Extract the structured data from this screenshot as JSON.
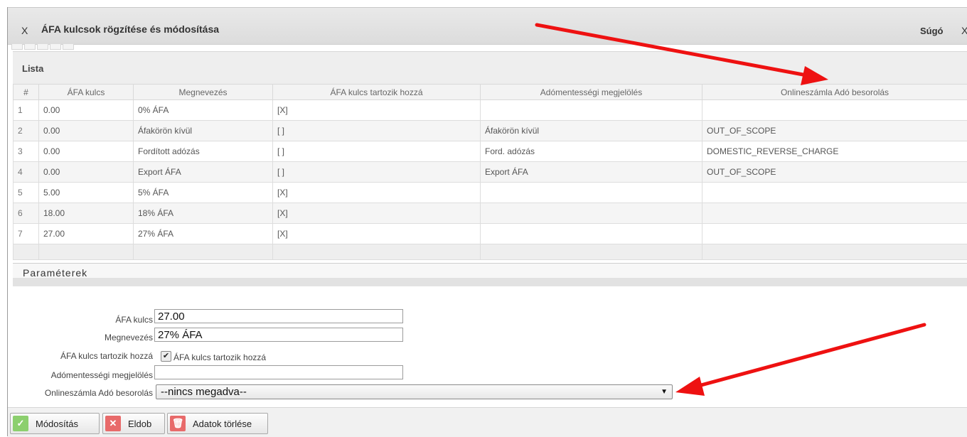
{
  "window": {
    "close_label": "X",
    "title": "ÁFA kulcsok rögzítése és módosítása",
    "help_label": "Súgó",
    "close_right_label": "X"
  },
  "list": {
    "title": "Lista",
    "columns": [
      "#",
      "ÁFA kulcs",
      "Megnevezés",
      "ÁFA kulcs tartozik hozzá",
      "Adómentességi megjelölés",
      "Onlineszámla Adó besorolás"
    ],
    "rows": [
      [
        "1",
        "0.00",
        "0% ÁFA",
        "[X]",
        "",
        ""
      ],
      [
        "2",
        "0.00",
        "Áfakörön kívül",
        "[ ]",
        "Áfakörön kívül",
        "OUT_OF_SCOPE"
      ],
      [
        "3",
        "0.00",
        "Fordított adózás",
        "[ ]",
        "Ford. adózás",
        "DOMESTIC_REVERSE_CHARGE"
      ],
      [
        "4",
        "0.00",
        "Export ÁFA",
        "[ ]",
        "Export ÁFA",
        "OUT_OF_SCOPE"
      ],
      [
        "5",
        "5.00",
        "5% ÁFA",
        "[X]",
        "",
        ""
      ],
      [
        "6",
        "18.00",
        "18% ÁFA",
        "[X]",
        "",
        ""
      ],
      [
        "7",
        "27.00",
        "27% ÁFA",
        "[X]",
        "",
        ""
      ]
    ]
  },
  "params": {
    "title": "Paraméterek",
    "afa_kulcs": {
      "label": "ÁFA kulcs",
      "value": "27.00"
    },
    "megnevezes": {
      "label": "Megnevezés",
      "value": "27% ÁFA"
    },
    "tartozik": {
      "label": "ÁFA kulcs tartozik hozzá",
      "checkbox_label": "ÁFA kulcs tartozik hozzá",
      "checked": true
    },
    "adomentes": {
      "label": "Adómentességi megjelölés",
      "value": ""
    },
    "online": {
      "label": "Onlineszámla Adó besorolás",
      "selected": "--nincs megadva--"
    }
  },
  "toolbar": {
    "modify_label": "Módosítás",
    "discard_label": "Eldob",
    "delete_label": "Adatok törlése"
  },
  "colors": {
    "arrow": "#ee1111",
    "modify_icon": "#8ccf6e",
    "discard_icon": "#e86a6a",
    "delete_icon": "#e86a6a"
  },
  "icons": [
    "check-icon",
    "x-icon",
    "trash-icon",
    "chevron-down-icon"
  ]
}
